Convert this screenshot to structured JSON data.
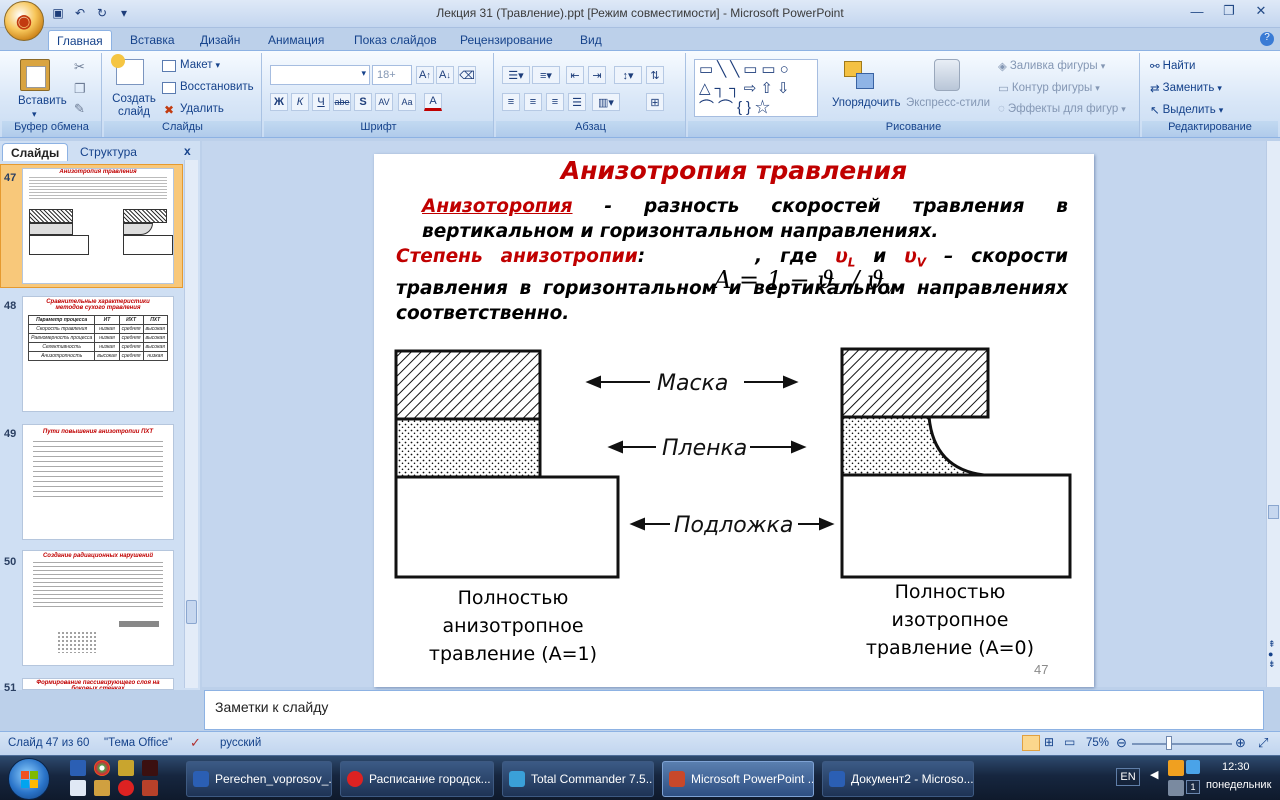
{
  "window": {
    "title": "Лекция 31 (Травление).ppt [Режим совместимости] - Microsoft PowerPoint",
    "min": "—",
    "max": "❐",
    "close": "✕"
  },
  "ribbon_tabs": [
    "Главная",
    "Вставка",
    "Дизайн",
    "Анимация",
    "Показ слайдов",
    "Рецензирование",
    "Вид"
  ],
  "ribbon": {
    "clipboard": {
      "label": "Буфер обмена",
      "paste": "Вставить"
    },
    "slides": {
      "label": "Слайды",
      "new_slide": "Создать слайд",
      "layout": "Макет",
      "reset": "Восстановить",
      "delete": "Удалить"
    },
    "font": {
      "label": "Шрифт",
      "size": "18+",
      "bold": "Ж",
      "italic": "К",
      "underline": "Ч",
      "strike": "abe",
      "shadow": "S"
    },
    "paragraph": {
      "label": "Абзац"
    },
    "drawing": {
      "label": "Рисование",
      "arrange": "Упорядочить",
      "quick_styles": "Экспресс-стили",
      "fill": "Заливка фигуры",
      "outline": "Контур фигуры",
      "effects": "Эффекты для фигур"
    },
    "editing": {
      "label": "Редактирование",
      "find": "Найти",
      "replace": "Заменить",
      "select": "Выделить"
    }
  },
  "panel_tabs": [
    "Слайды",
    "Структура"
  ],
  "thumbnails": [
    {
      "num": "47",
      "title": "Анизотропия травления"
    },
    {
      "num": "48",
      "title": "Сравнительные характеристики методов сухого травления",
      "table": [
        [
          "Параметр процесса",
          "ИТ",
          "ИХТ",
          "ПХТ"
        ],
        [
          "Скорость травления",
          "низкая",
          "средняя",
          "высокая"
        ],
        [
          "Равномерность процесса",
          "низкая",
          "средняя",
          "высокая"
        ],
        [
          "Селективность",
          "низкая",
          "средняя",
          "высокая"
        ],
        [
          "Анизотропность",
          "высокая",
          "средняя",
          "низкая"
        ]
      ]
    },
    {
      "num": "49",
      "title": "Пути повышения анизотропии ПХТ"
    },
    {
      "num": "50",
      "title": "Создание радиационных нарушений"
    },
    {
      "num": "51",
      "title": "Формирование пассивирующего слоя на боковых стенках"
    }
  ],
  "slide": {
    "title": "Анизотропия травления",
    "p1_term": "Анизоторопия",
    "p1_rest": " - разность скоростей травления в вертикальном и горизонтальном направлениях.",
    "p2_term": "Степень анизотропии",
    "p2_colon": ":",
    "p2_where": ", где ",
    "vL": "υ",
    "vL_sub": "L",
    "and": " и ",
    "vV": "υ",
    "vV_sub": "V",
    "p2_rest": " – скорости травления в горизонтальном и вертикальном направлениях соответственно.",
    "formula": "A = 1 − ϑ",
    "formula_l": "L",
    "formula_slash": " / ϑ",
    "formula_v": "V",
    "label_mask": "Маска",
    "label_film": "Пленка",
    "label_substrate": "Подложка",
    "caption_left": "Полностью анизотропное травление (A=1)",
    "caption_right": "Полностью изотропное травление (A=0)",
    "page_number": "47"
  },
  "notes_placeholder": "Заметки к слайду",
  "status": {
    "slide": "Слайд 47 из 60",
    "theme": "\"Тема Office\"",
    "lang": "русский",
    "zoom": "75%"
  },
  "taskbar": {
    "buttons": [
      "Perechen_voprosov_...",
      "Расписание городск...",
      "Total Commander 7.5...",
      "Microsoft PowerPoint ...",
      "Документ2 - Microso..."
    ],
    "lang": "EN",
    "time": "12:30",
    "day": "понедельник",
    "badge": "1"
  },
  "colors": {
    "accent_red": "#c00000",
    "ribbon_blue": "#15428b",
    "selected_thumb": "#f8c87a"
  }
}
